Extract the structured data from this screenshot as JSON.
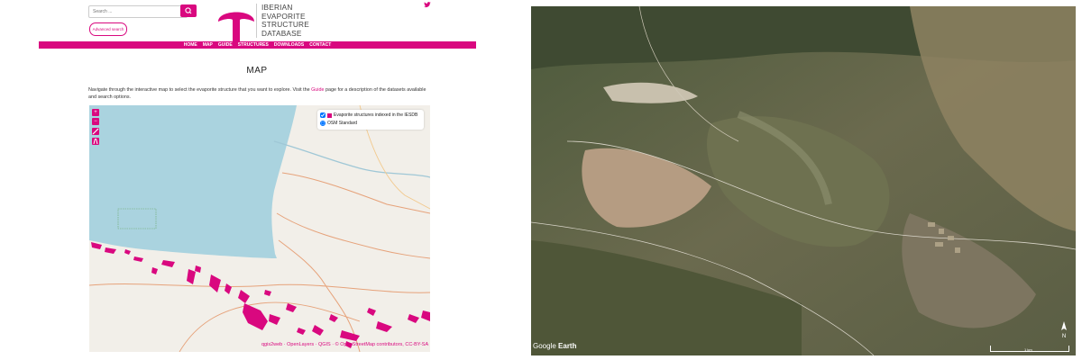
{
  "search": {
    "placeholder": "Search ..."
  },
  "advanced_search_label": "Advanced search",
  "logo_lines": [
    "IBERIAN",
    "EVAPORITE",
    "STRUCTURE",
    "DATABASE"
  ],
  "nav": [
    "HOME",
    "MAP",
    "GUIDE",
    "STRUCTURES",
    "DOWNLOADS",
    "CONTACT"
  ],
  "page_title": "MAP",
  "intro": {
    "before": "Navigate through the interactive map to select the evaporite structure that you want to explore. Visit the ",
    "link": "Guide",
    "after": " page for a description of the datasets available and search options."
  },
  "map": {
    "controls": [
      "+",
      "−"
    ],
    "layers": [
      {
        "label": "Evaporite structures indexed in the IESDB",
        "checked": true
      },
      {
        "label": "OSM Standard",
        "checked": true
      }
    ],
    "attribution": "qgis2web · OpenLayers · QGIS · © OpenStreetMap contributors, CC-BY-SA"
  },
  "satellite": {
    "watermark_brand": "Google",
    "watermark_product": "Earth",
    "scale_label": "1 km"
  },
  "colors": {
    "accent": "#d9087f",
    "sea": "#aad3df",
    "land": "#f2efe9"
  },
  "icons": {
    "social": "twitter-icon",
    "search": "search-icon",
    "north": "compass-north-icon"
  }
}
